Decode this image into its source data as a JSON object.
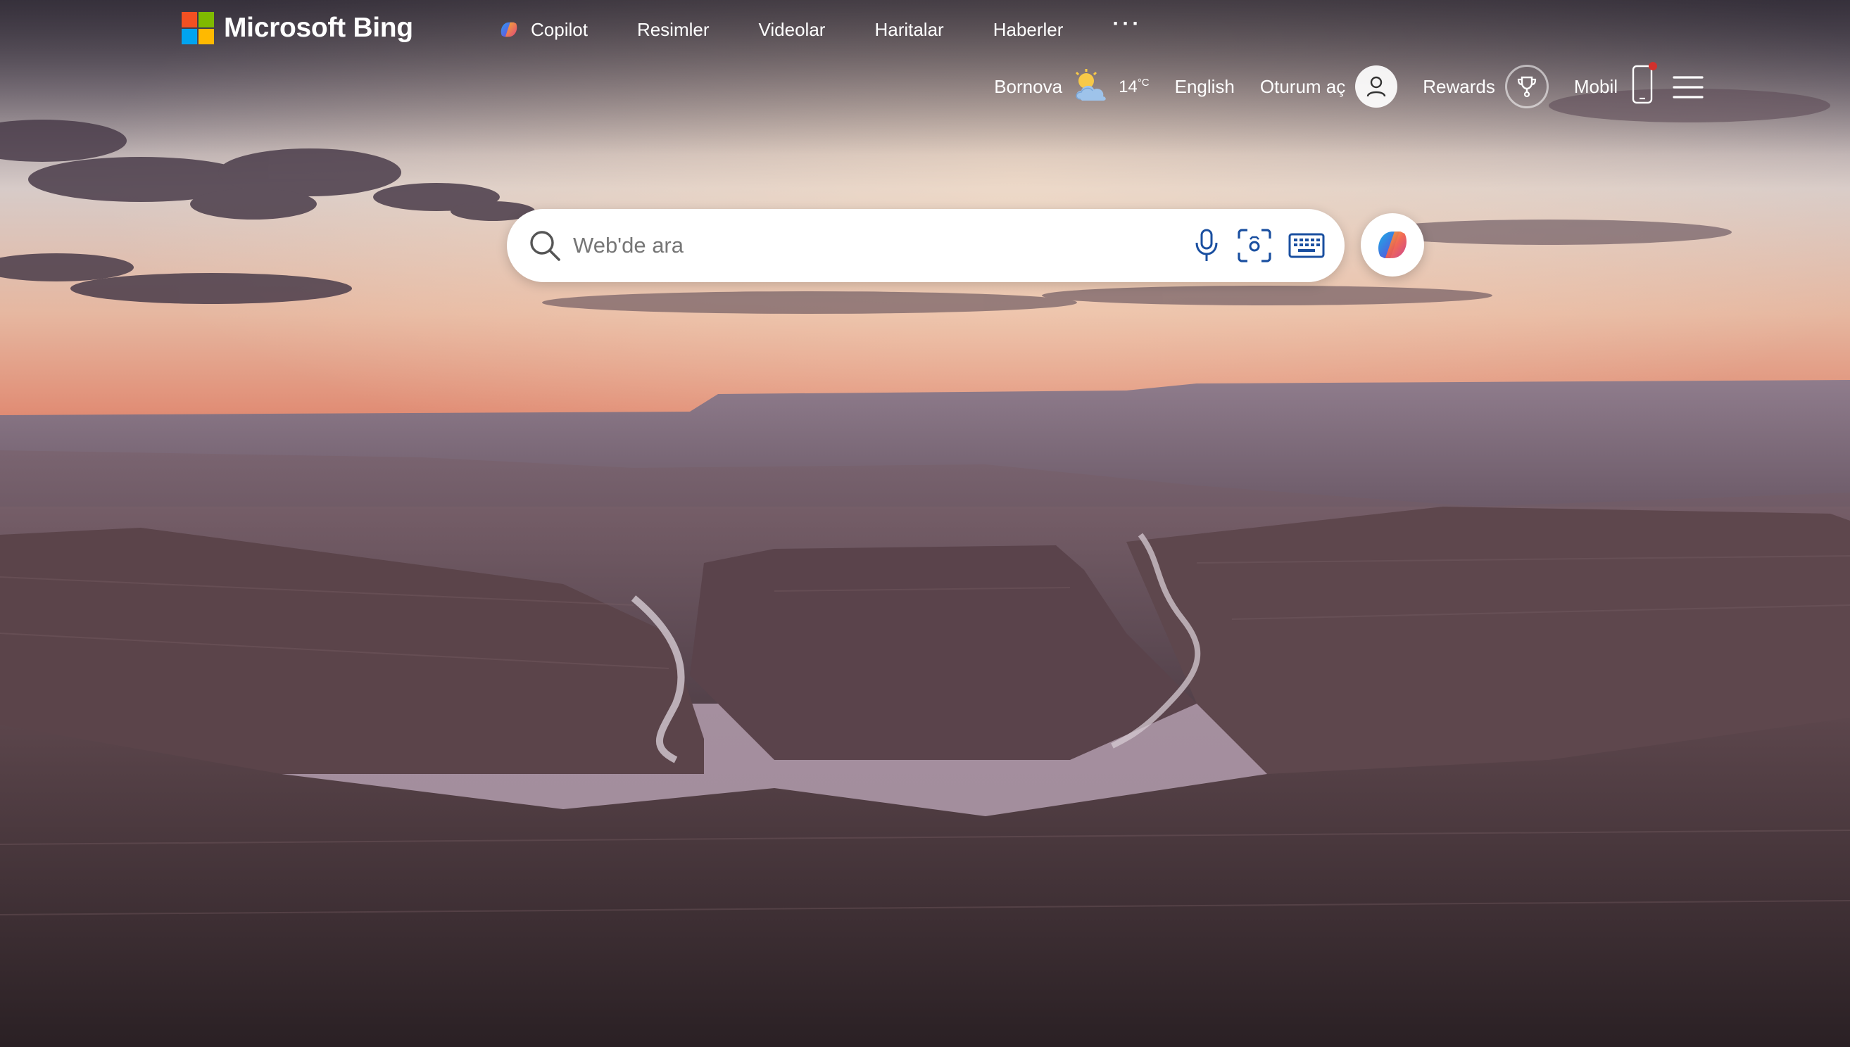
{
  "brand": {
    "name": "Microsoft Bing",
    "logo_colors": [
      "#f25022",
      "#7fba00",
      "#00a4ef",
      "#ffb900"
    ]
  },
  "scopes": [
    {
      "label": "Copilot",
      "icon": "copilot-icon"
    },
    {
      "label": "Resimler"
    },
    {
      "label": "Videolar"
    },
    {
      "label": "Haritalar"
    },
    {
      "label": "Haberler"
    }
  ],
  "more_label": "···",
  "weather": {
    "location": "Bornova",
    "temperature": "14",
    "unit": "°C",
    "icon": "partly-cloudy-icon"
  },
  "language_link": "English",
  "signin": {
    "label": "Oturum aç",
    "icon": "person-icon"
  },
  "rewards": {
    "label": "Rewards",
    "icon": "trophy-icon"
  },
  "mobile": {
    "label": "Mobil",
    "icon": "phone-icon",
    "notification": true
  },
  "menu_icon": "hamburger-icon",
  "search": {
    "placeholder": "Web'de ara",
    "value": "",
    "tools": [
      "microphone-icon",
      "visual-search-icon",
      "keyboard-icon"
    ]
  },
  "copilot_button_icon": "copilot-icon"
}
